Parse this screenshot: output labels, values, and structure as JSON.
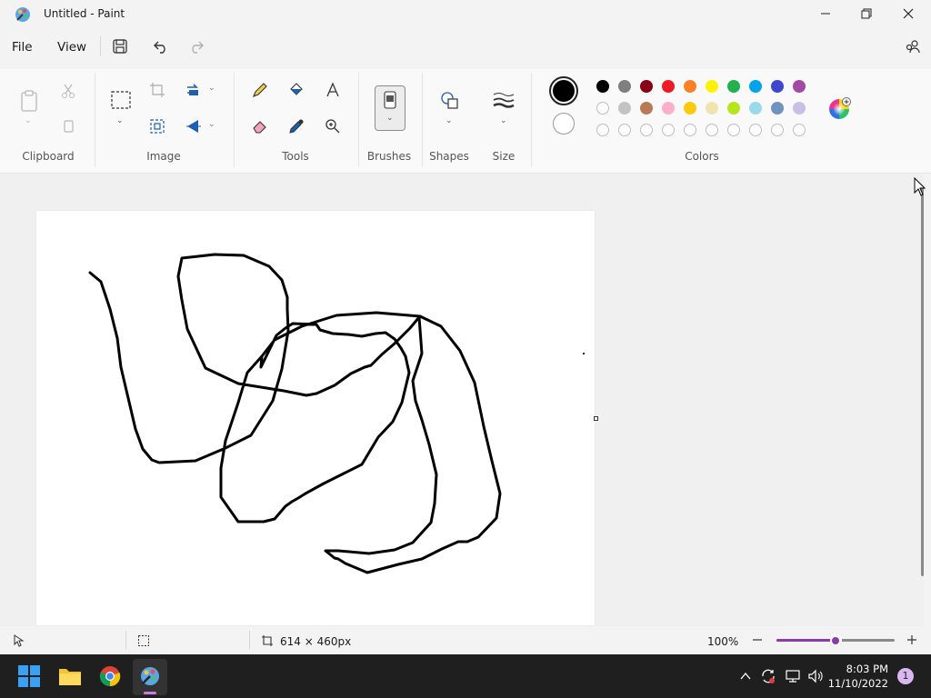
{
  "window": {
    "title": "Untitled - Paint"
  },
  "menu": {
    "file": "File",
    "view": "View"
  },
  "ribbon": {
    "groups": {
      "clipboard": "Clipboard",
      "image": "Image",
      "tools": "Tools",
      "brushes": "Brushes",
      "shapes": "Shapes",
      "size": "Size",
      "colors": "Colors"
    },
    "primary_color": "#000000",
    "secondary_color": "#ffffff",
    "palette_row1": [
      "#000000",
      "#7f7f7f",
      "#880015",
      "#ed1c24",
      "#ff7f27",
      "#fff200",
      "#22b14c",
      "#00a2e8",
      "#3f48cc",
      "#a349a4"
    ],
    "palette_row2": [
      "#ffffff",
      "#c3c3c3",
      "#b97a57",
      "#ffaec9",
      "#ffc90e",
      "#efe4b0",
      "#b5e61d",
      "#99d9ea",
      "#7092be",
      "#c8bfe7"
    ]
  },
  "status": {
    "canvas_size": "614 × 460px",
    "zoom": "100%",
    "zoom_level": 0.5
  },
  "taskbar": {
    "time": "8:03 PM",
    "date": "11/10/2022",
    "notification_count": "1"
  }
}
